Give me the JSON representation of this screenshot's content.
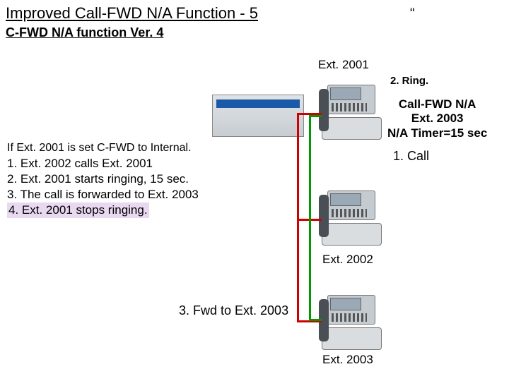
{
  "title": "Improved Call-FWD N/A Function - 5",
  "subtitle": "C-FWD N/A function Ver. 4",
  "quote": "“",
  "labels": {
    "ext2001": "Ext. 2001",
    "ext2002": "Ext. 2002",
    "ext2003": "Ext. 2003",
    "ring": "2. Ring.",
    "fwd_info_l1": "Call-FWD N/A",
    "fwd_info_l2": "Ext. 2003",
    "fwd_info_l3": "N/A Timer=15 sec",
    "call": "1. Call",
    "fwd": "3. Fwd to Ext. 2003"
  },
  "scenario": {
    "cond": "If Ext. 2001 is set C-FWD to Internal.",
    "s1": "1. Ext. 2002 calls Ext. 2001",
    "s2": "2. Ext. 2001 starts ringing, 15 sec.",
    "s3": "3. The call is forwarded to Ext. 2003",
    "s4": "4. Ext. 2001 stops ringing."
  }
}
